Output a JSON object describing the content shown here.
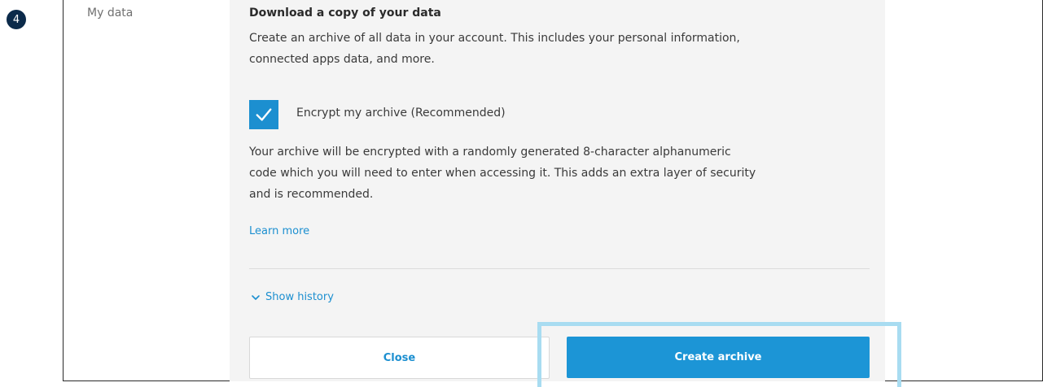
{
  "step": {
    "number": "4"
  },
  "sidebar": {
    "label": "My data"
  },
  "section": {
    "title": "Download a copy of your data",
    "description_line1": "Create an archive of all data in your account. This includes your personal information,",
    "description_line2": "connected apps data, and more."
  },
  "encrypt": {
    "checked": true,
    "label": "Encrypt my archive (Recommended)",
    "description_line1": "Your archive will be encrypted with a randomly generated 8-character alphanumeric",
    "description_line2": "code which you will need to enter when accessing it. This adds an extra layer of security",
    "description_line3": "and is recommended.",
    "learn_more": "Learn more"
  },
  "history": {
    "label": "Show history",
    "icon": "chevron-down-icon"
  },
  "actions": {
    "close_label": "Close",
    "create_label": "Create archive"
  },
  "colors": {
    "accent": "#1c8fd0",
    "primary_button": "#1c95d6",
    "highlight": "#a8dcf1",
    "badge": "#0b2a4a"
  }
}
